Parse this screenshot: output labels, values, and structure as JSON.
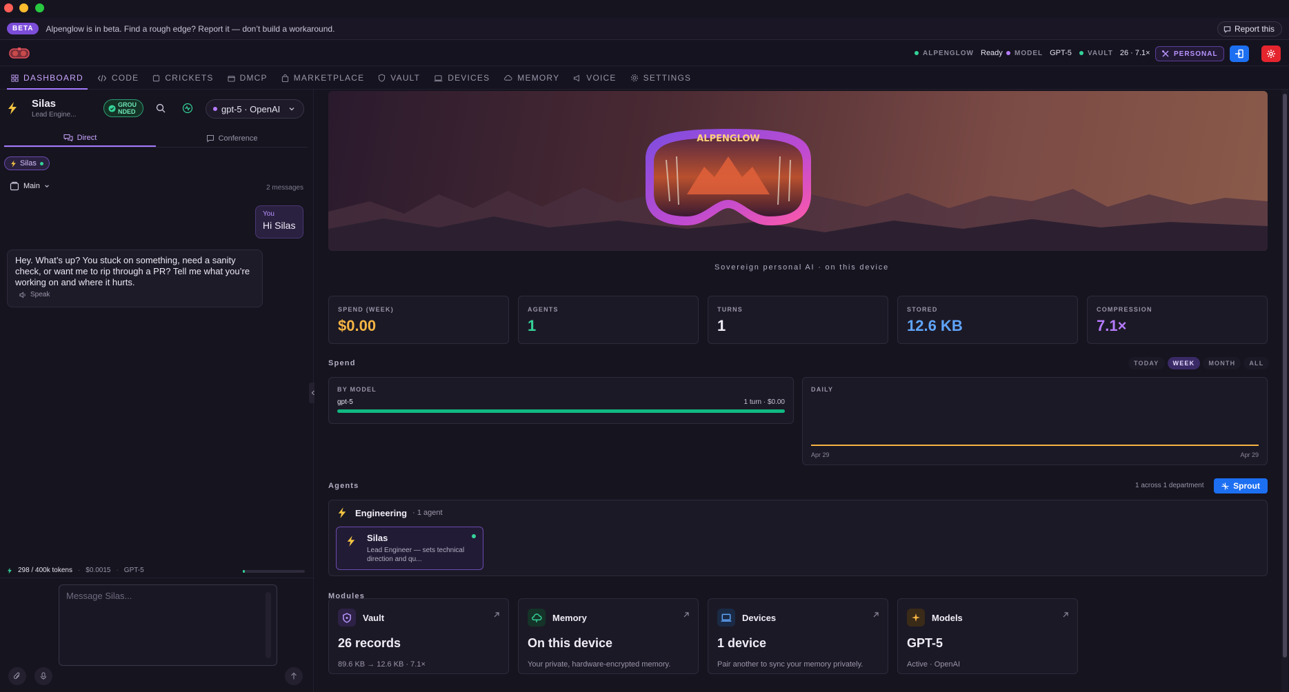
{
  "beta": {
    "badge": "BETA",
    "message": "Alpenglow is in beta. Find a rough edge? Report it — don’t build a workaround.",
    "report_label": "Report this"
  },
  "status": {
    "alpenglow_key": "ALPENGLOW",
    "alpenglow_val": "Ready",
    "model_key": "MODEL",
    "model_val": "GPT-5",
    "vault_key": "VAULT",
    "vault_val": "26 · 7.1×",
    "mode": "PERSONAL"
  },
  "nav": {
    "tabs": [
      "DASHBOARD",
      "CODE",
      "CRICKETS",
      "DMCP",
      "MARKETPLACE",
      "VAULT",
      "DEVICES",
      "MEMORY",
      "VOICE",
      "SETTINGS"
    ],
    "active": "DASHBOARD"
  },
  "chat": {
    "agent_name": "Silas",
    "agent_role": "Lead Engine...",
    "grounded_l1": "GROU",
    "grounded_l2": "NDED",
    "model_selector": "gpt-5 · OpenAI",
    "tab_direct": "Direct",
    "tab_conference": "Conference",
    "chip": "Silas",
    "thread": "Main",
    "message_count": "2 messages",
    "user_msg": {
      "who": "You",
      "text": "Hi Silas"
    },
    "ai_msg": {
      "text": "Hey. What’s up? You stuck on something, need a sanity check, or want me to rip through a PR? Tell me what you’re working on and where it hurts.",
      "speak": "Speak"
    },
    "usage": {
      "tokens": "298 / 400k tokens",
      "cost": "$0.0015",
      "model": "GPT-5",
      "fill_fraction": 0.007
    },
    "composer_placeholder": "Message Silas..."
  },
  "dashboard": {
    "hero_logo_text": "ALPENGLOW",
    "tagline": "Sovereign personal AI · on this device",
    "stats": [
      {
        "label": "SPEND (WEEK)",
        "value": "$0.00",
        "color": "#f5b544"
      },
      {
        "label": "AGENTS",
        "value": "1",
        "color": "#34d399"
      },
      {
        "label": "TURNS",
        "value": "1",
        "color": "#f0edf7"
      },
      {
        "label": "STORED",
        "value": "12.6 KB",
        "color": "#60a5fa"
      },
      {
        "label": "COMPRESSION",
        "value": "7.1×",
        "color": "#b57bff"
      }
    ],
    "spend": {
      "title": "Spend",
      "ranges": [
        "TODAY",
        "WEEK",
        "MONTH",
        "ALL"
      ],
      "active_range": "WEEK",
      "by_model_label": "BY MODEL",
      "model_name": "gpt-5",
      "model_detail": "1 turn · $0.00",
      "model_share": 1.0,
      "daily_label": "DAILY",
      "daily_start": "Apr 29",
      "daily_end": "Apr 29"
    },
    "agents": {
      "title": "Agents",
      "summary": "1 across 1 department",
      "sprout_label": "Sprout",
      "department": "Engineering",
      "dept_count": "· 1 agent",
      "card_name": "Silas",
      "card_desc": "Lead Engineer — sets technical direction and qu..."
    },
    "modules": {
      "title": "Modules",
      "items": [
        {
          "name": "Vault",
          "big": "26 records",
          "sub": "89.6 KB → 12.6 KB · 7.1×",
          "icon": "shield-icon"
        },
        {
          "name": "Memory",
          "big": "On this device",
          "sub": "Your private, hardware-encrypted memory.",
          "icon": "cloud-icon"
        },
        {
          "name": "Devices",
          "big": "1 device",
          "sub": "Pair another to sync your memory privately.",
          "icon": "laptop-icon"
        },
        {
          "name": "Models",
          "big": "GPT-5",
          "sub": "Active · OpenAI",
          "icon": "sparkle-icon"
        }
      ]
    }
  }
}
